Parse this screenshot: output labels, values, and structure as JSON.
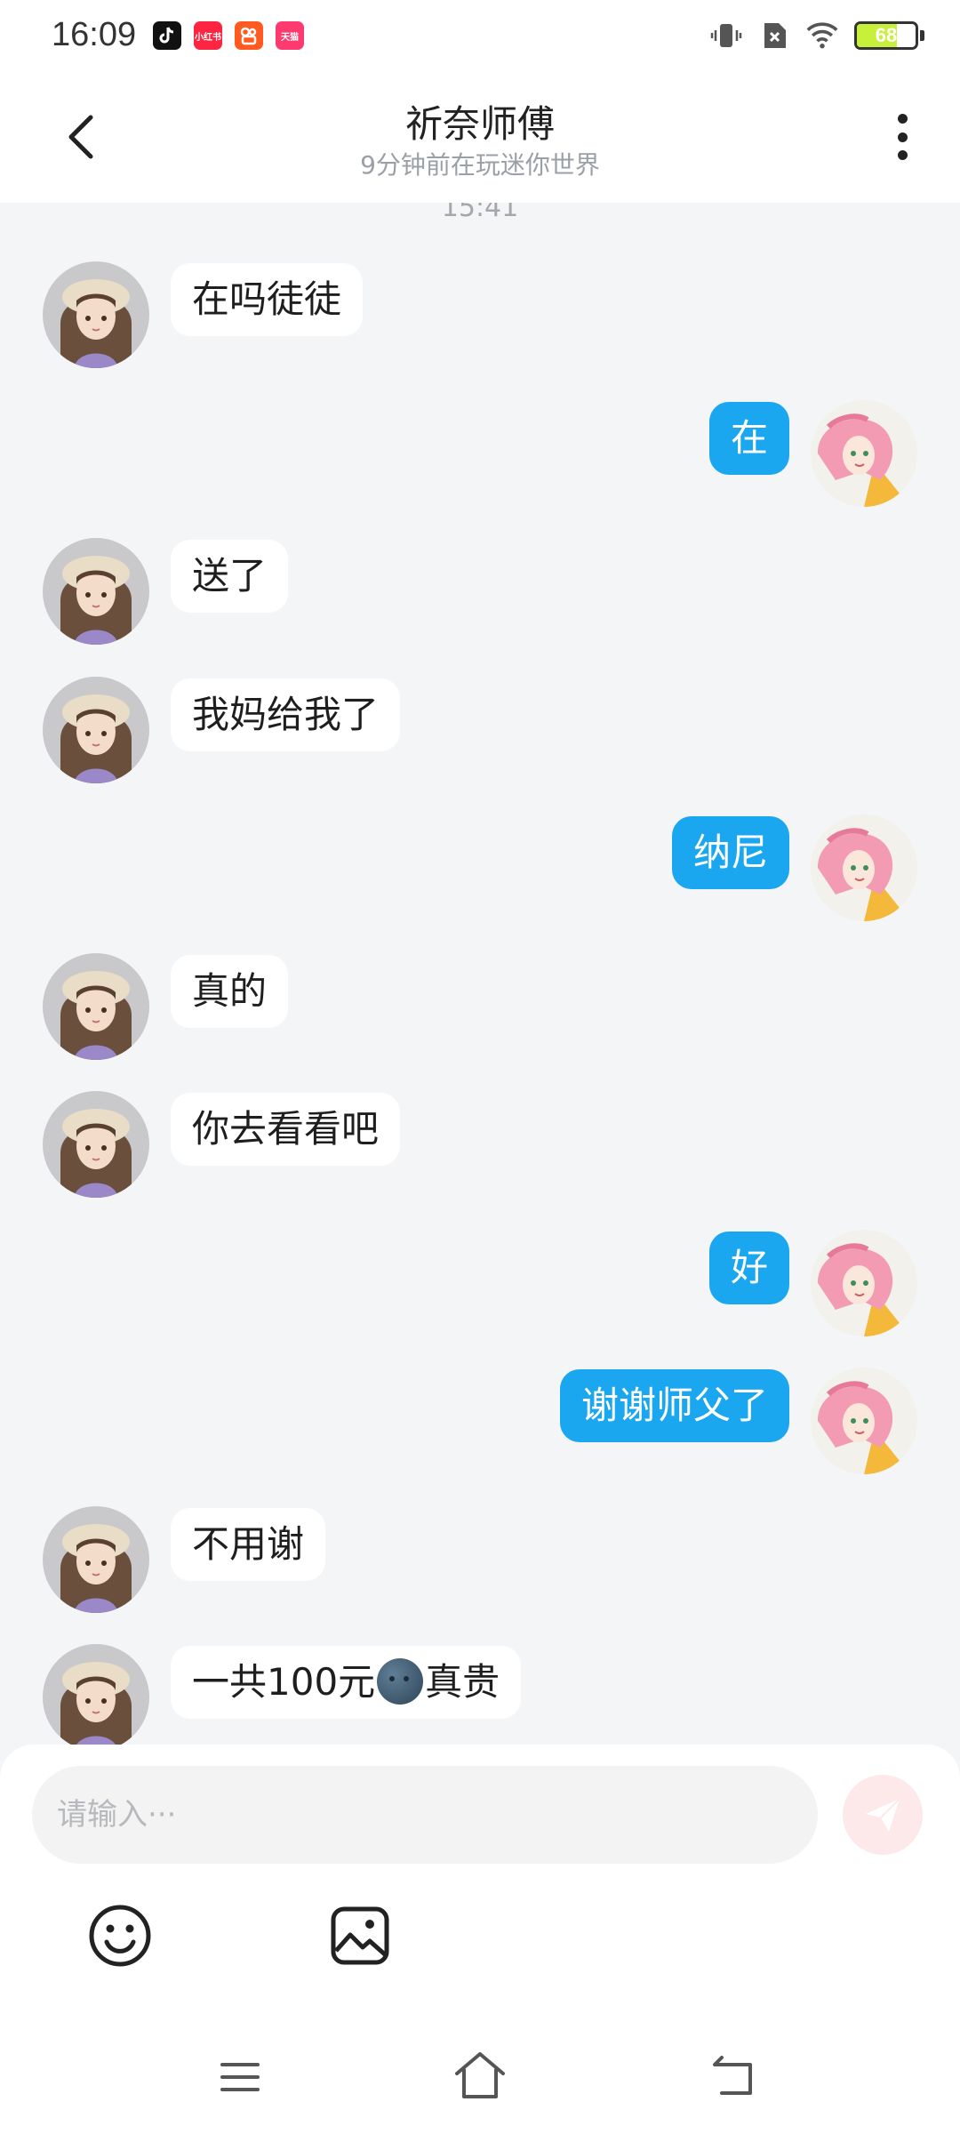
{
  "status_bar": {
    "time": "16:09",
    "apps": [
      {
        "name": "tiktok-app-icon",
        "label": "",
        "color": "#111111"
      },
      {
        "name": "xiaohongshu-app-icon",
        "label": "小红书",
        "color": "#ff2442"
      },
      {
        "name": "kuaishou-app-icon",
        "label": "",
        "color": "#ff5a1f"
      },
      {
        "name": "taobao-app-icon",
        "label": "天猫",
        "color": "#ff3a6e"
      }
    ],
    "battery_level": "68",
    "battery_fraction": 0.68
  },
  "header": {
    "title": "祈奈师傅",
    "subtitle": "9分钟前在玩迷你世界"
  },
  "chat": {
    "timestamp": "15:41",
    "messages": [
      {
        "side": "left",
        "text": "在吗徒徒"
      },
      {
        "side": "right",
        "text": "在"
      },
      {
        "side": "left",
        "text": "送了"
      },
      {
        "side": "left",
        "text": "我妈给我了"
      },
      {
        "side": "right",
        "text": "纳尼"
      },
      {
        "side": "left",
        "text": "真的"
      },
      {
        "side": "left",
        "text": "你去看看吧"
      },
      {
        "side": "right",
        "text": "好"
      },
      {
        "side": "right",
        "text": "谢谢师父了"
      },
      {
        "side": "left",
        "text": "不用谢"
      },
      {
        "side": "left",
        "text_before": "一共100元",
        "emoji": "moon-face-emoji",
        "text_after": "真贵"
      }
    ]
  },
  "input": {
    "placeholder": "请输入···",
    "value": ""
  },
  "colors": {
    "accent_blue": "#1aa7ef",
    "send_button_bg": "#fde9ea",
    "send_icon": "#ffffff",
    "chat_bg": "#f4f5f7"
  }
}
